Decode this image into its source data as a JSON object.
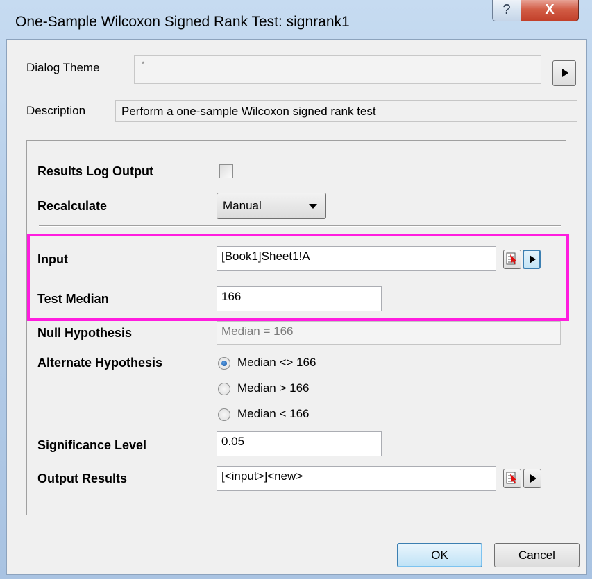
{
  "window": {
    "title": "One-Sample Wilcoxon Signed Rank Test: signrank1",
    "help_glyph": "?",
    "close_glyph": "X"
  },
  "dialog_theme": {
    "label": "Dialog Theme",
    "value": "*"
  },
  "description": {
    "label": "Description",
    "value": "Perform a one-sample Wilcoxon signed rank test"
  },
  "results_log_output": {
    "label": "Results Log Output",
    "checked": false
  },
  "recalculate": {
    "label": "Recalculate",
    "value": "Manual"
  },
  "input": {
    "label": "Input",
    "value": "[Book1]Sheet1!A"
  },
  "test_median": {
    "label": "Test Median",
    "value": "166"
  },
  "null_hypothesis": {
    "label": "Null Hypothesis",
    "value": "Median = 166"
  },
  "alternate_hypothesis": {
    "label": "Alternate Hypothesis",
    "options": [
      "Median <> 166",
      "Median > 166",
      "Median < 166"
    ],
    "selected": "Median <> 166"
  },
  "significance_level": {
    "label": "Significance Level",
    "value": "0.05"
  },
  "output_results": {
    "label": "Output Results",
    "value": "[<input>]<new>"
  },
  "buttons": {
    "ok": "OK",
    "cancel": "Cancel"
  },
  "colors": {
    "highlight": "#ff1ddf",
    "close_button": "#c94a33",
    "selected_radio": "#1a5fb4"
  }
}
